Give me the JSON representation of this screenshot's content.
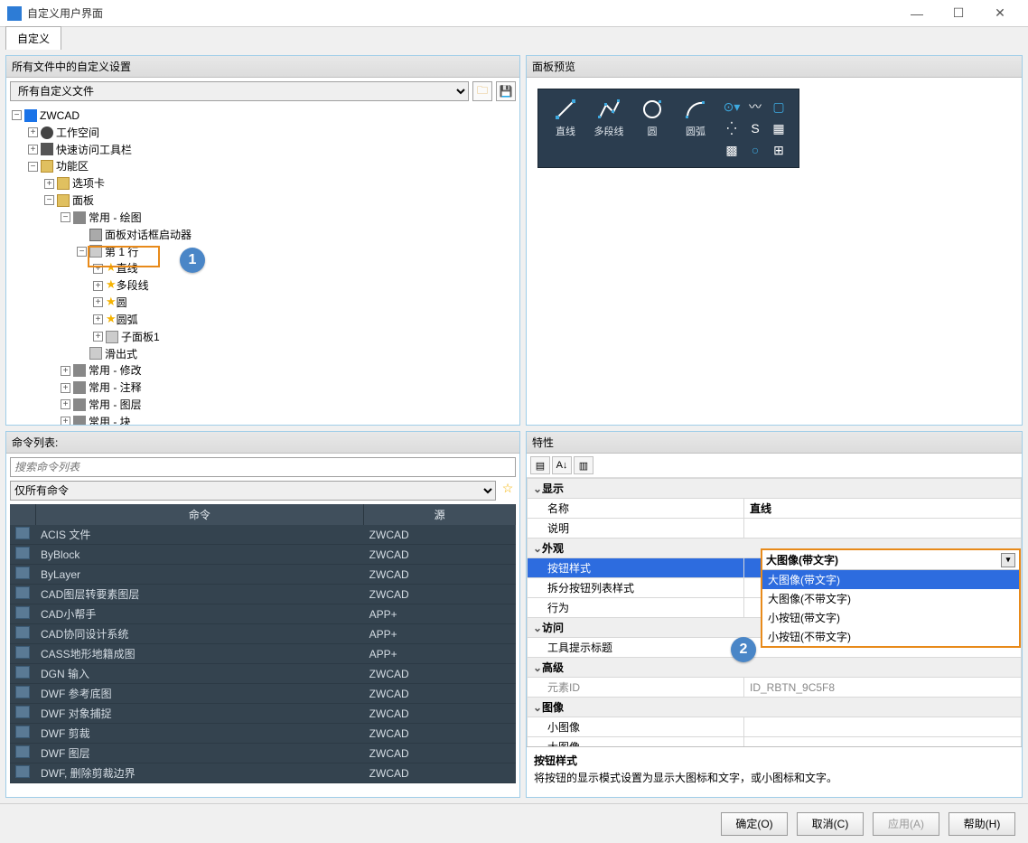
{
  "title": "自定义用户界面",
  "top_tab": "自定义",
  "panels": {
    "tl_head": "所有文件中的自定义设置",
    "tr_head": "面板预览",
    "bl_head": "命令列表:",
    "br_head": "特性"
  },
  "tl": {
    "file_select": "所有自定义文件",
    "tree": {
      "root": "ZWCAD",
      "workspace": "工作空间",
      "qat": "快速访问工具栏",
      "ribbon": "功能区",
      "tabs": "选项卡",
      "panels": "面板",
      "p_draw": "常用 - 绘图",
      "dlg_launcher": "面板对话框启动器",
      "row1": "第 1 行",
      "line": "直线",
      "pline": "多段线",
      "circle": "圆",
      "arc": "圆弧",
      "subpanel": "子面板1",
      "slideout": "滑出式",
      "p_modify": "常用 - 修改",
      "p_annot": "常用 - 注释",
      "p_layer": "常用 - 图层",
      "p_block": "常用 - 块"
    }
  },
  "preview": {
    "b1": "直线",
    "b2": "多段线",
    "b3": "圆",
    "b4": "圆弧"
  },
  "bl": {
    "search_placeholder": "搜索命令列表",
    "filter": "仅所有命令",
    "col_cmd": "命令",
    "col_src": "源",
    "rows": [
      {
        "cmd": "ACIS 文件",
        "src": "ZWCAD"
      },
      {
        "cmd": "ByBlock",
        "src": "ZWCAD"
      },
      {
        "cmd": "ByLayer",
        "src": "ZWCAD"
      },
      {
        "cmd": "CAD图层转要素图层",
        "src": "ZWCAD"
      },
      {
        "cmd": "CAD小帮手",
        "src": "APP+"
      },
      {
        "cmd": "CAD协同设计系统",
        "src": "APP+"
      },
      {
        "cmd": "CASS地形地籍成图",
        "src": "APP+"
      },
      {
        "cmd": "DGN 输入",
        "src": "ZWCAD"
      },
      {
        "cmd": "DWF 参考底图",
        "src": "ZWCAD"
      },
      {
        "cmd": "DWF 对象捕捉",
        "src": "ZWCAD"
      },
      {
        "cmd": "DWF 剪裁",
        "src": "ZWCAD"
      },
      {
        "cmd": "DWF 图层",
        "src": "ZWCAD"
      },
      {
        "cmd": "DWF, 删除剪裁边界",
        "src": "ZWCAD"
      }
    ]
  },
  "br": {
    "cat_display": "显示",
    "k_name": "名称",
    "v_name": "直线",
    "k_desc": "说明",
    "cat_appear": "外观",
    "k_btnstyle": "按钮样式",
    "v_btnstyle": "大图像(带文字)",
    "k_split": "拆分按钮列表样式",
    "k_behavior": "行为",
    "cat_access": "访问",
    "k_tooltip": "工具提示标题",
    "cat_adv": "高级",
    "k_elemid": "元素ID",
    "v_elemid": "ID_RBTN_9C5F8",
    "cat_image": "图像",
    "k_simg": "小图像",
    "k_limg": "大图像",
    "dd": {
      "o1": "大图像(带文字)",
      "o2": "大图像(不带文字)",
      "o3": "小按钮(带文字)",
      "o4": "小按钮(不带文字)"
    },
    "desc_title": "按钮样式",
    "desc_body": "将按钮的显示模式设置为显示大图标和文字，或小图标和文字。"
  },
  "buttons": {
    "ok": "确定(O)",
    "cancel": "取消(C)",
    "apply": "应用(A)",
    "help": "帮助(H)"
  },
  "callout1": "1",
  "callout2": "2"
}
